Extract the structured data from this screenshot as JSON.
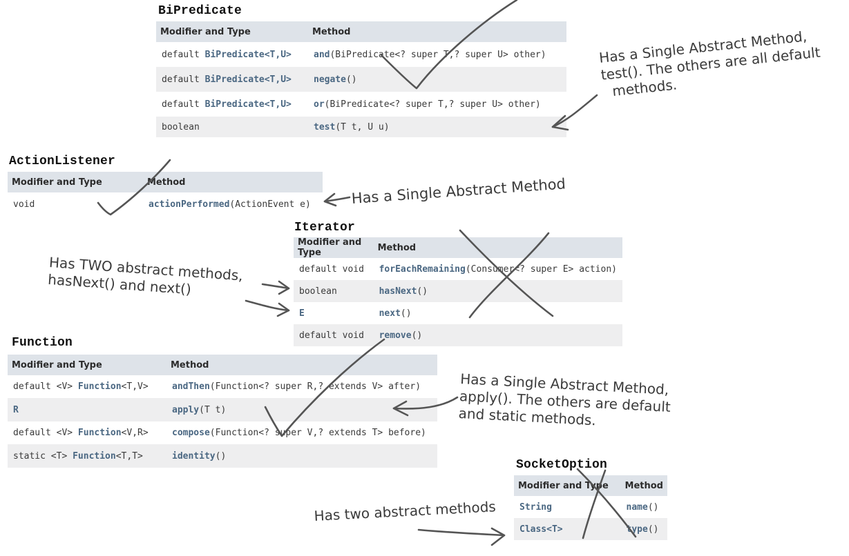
{
  "header_modifier": "Modifier and Type",
  "header_method": "Method",
  "bipredicate": {
    "title": "BiPredicate",
    "rows": [
      {
        "mod_pre": "default ",
        "mod_type": "BiPredicate",
        "mod_post": "<T,U>",
        "m_name": "and",
        "m_sig": "(BiPredicate<? super T,? super U> other)"
      },
      {
        "mod_pre": "default ",
        "mod_type": "BiPredicate",
        "mod_post": "<T,U>",
        "m_name": "negate",
        "m_sig": "()"
      },
      {
        "mod_pre": "default ",
        "mod_type": "BiPredicate",
        "mod_post": "<T,U>",
        "m_name": "or",
        "m_sig": "(BiPredicate<? super T,? super U> other)"
      },
      {
        "mod_pre": "boolean",
        "mod_type": "",
        "mod_post": "",
        "m_name": "test",
        "m_sig": "(T t, U u)"
      }
    ]
  },
  "actionlistener": {
    "title": "ActionListener",
    "rows": [
      {
        "mod_pre": "void",
        "m_name": "actionPerformed",
        "m_sig": "(ActionEvent e)"
      }
    ]
  },
  "iterator": {
    "title": "Iterator",
    "rows": [
      {
        "mod_pre": "default void",
        "m_name": "forEachRemaining",
        "m_sig": "(Consumer<? super E> action)"
      },
      {
        "mod_pre": "boolean",
        "m_name": "hasNext",
        "m_sig": "()"
      },
      {
        "mod_pre": "E",
        "m_name": "next",
        "m_sig": "()"
      },
      {
        "mod_pre": "default void",
        "m_name": "remove",
        "m_sig": "()"
      }
    ]
  },
  "function": {
    "title": "Function",
    "rows": [
      {
        "mod_pre": "default <V> ",
        "mod_type": "Function",
        "mod_post": "<T,V>",
        "m_name": "andThen",
        "m_sig": "(Function<? super R,? extends V> after)"
      },
      {
        "mod_pre": "R",
        "mod_type": "",
        "mod_post": "",
        "m_name": "apply",
        "m_sig": "(T t)"
      },
      {
        "mod_pre": "default <V> ",
        "mod_type": "Function",
        "mod_post": "<V,R>",
        "m_name": "compose",
        "m_sig": "(Function<? super V,? extends T> before)"
      },
      {
        "mod_pre": "static <T> ",
        "mod_type": "Function",
        "mod_post": "<T,T>",
        "m_name": "identity",
        "m_sig": "()"
      }
    ]
  },
  "socketoption": {
    "title": "SocketOption",
    "rows": [
      {
        "mod_pre": "String",
        "m_name": "name",
        "m_sig": "()"
      },
      {
        "mod_pre": "Class<T>",
        "m_name": "type",
        "m_sig": "()"
      }
    ]
  },
  "notes": {
    "bipredicate": [
      "Has a Single Abstract Method,",
      "test(). The others are all default",
      "methods."
    ],
    "actionlistener": "Has a Single Abstract Method",
    "iterator": [
      "Has TWO abstract methods,",
      "hasNext() and next()"
    ],
    "function": [
      "Has a Single Abstract Method,",
      "apply(). The others are default",
      "and static methods."
    ],
    "socketoption": "Has two abstract methods"
  }
}
